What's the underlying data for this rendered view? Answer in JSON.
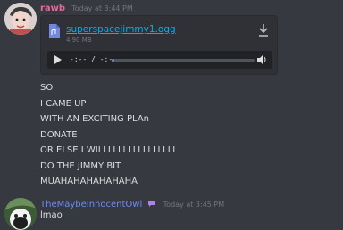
{
  "messages": [
    {
      "author": "rawb",
      "timestamp": "Today at 3:44 PM",
      "attachment": {
        "file_name": "superspacejimmy1.ogg",
        "file_size": "4.90 MB",
        "time_display": "-:-- / -:--",
        "progress": 0.02,
        "icons": [
          "file-audio-icon",
          "download-icon",
          "play-icon",
          "volume-icon"
        ]
      },
      "lines": [
        "SO",
        "I CAME UP",
        "WITH AN EXCITING PLAn",
        "DONATE",
        "OR ELSE I WILLLLLLLLLLLLLLLL",
        "DO THE JIMMY BIT",
        "MUAHAHAHAHAHAHA"
      ]
    },
    {
      "author": "TheMaybeInnocentOwl",
      "timestamp": "Today at 3:45 PM",
      "lines": [
        "lmao"
      ]
    }
  ],
  "colors": {
    "background": "#36393f",
    "rawb_name": "#e36d98",
    "owl_name": "#6e8cf3",
    "link": "#00b0f4",
    "timestamp": "#72767d"
  }
}
